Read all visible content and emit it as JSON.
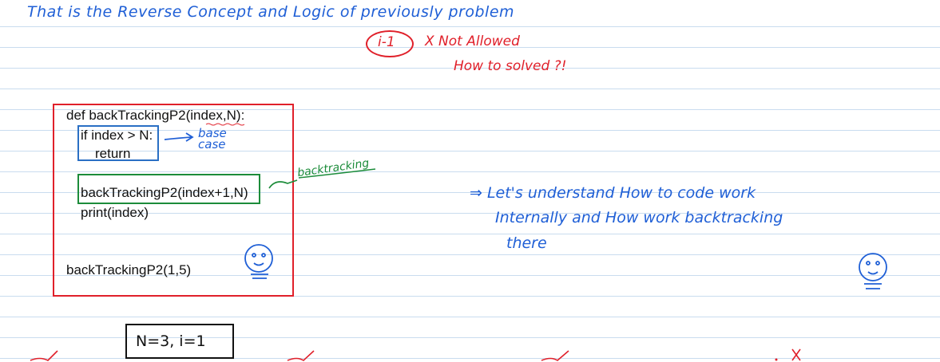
{
  "heading": "That is the Reverse Concept and Logic of previously problem",
  "note_circle": "i-1",
  "note_not_allowed": "X Not Allowed",
  "note_how": "How to solved ?!",
  "code": {
    "line1": "def backTrackingP2(index,N):",
    "line2": "if index > N:",
    "line3": "return",
    "line4": "backTrackingP2(index+1,N)",
    "line5": "print(index)",
    "line6": "backTrackingP2(1,5)"
  },
  "annotation_base_case": "base case",
  "annotation_backtracking": "backtracking",
  "explain_line1": "⇒ Let's understand How to code work",
  "explain_line2": "Internally and How work backtracking",
  "explain_line3": "there",
  "n_box": "N=3, i=1",
  "colors": {
    "blue_ink": "#1f5fd6",
    "red_ink": "#e0202a",
    "green_ink": "#1c8c3a",
    "ruled_lines": "#c9dcef"
  }
}
